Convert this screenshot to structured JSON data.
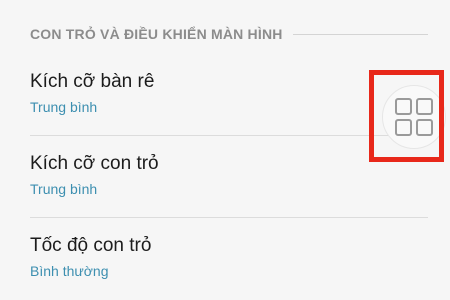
{
  "section": {
    "title": "CON TRỎ VÀ ĐIỀU KHIỂN MÀN HÌNH"
  },
  "items": [
    {
      "title": "Kích cỡ bàn rê",
      "value": "Trung bình"
    },
    {
      "title": "Kích cỡ con trỏ",
      "value": "Trung bình"
    },
    {
      "title": "Tốc độ con trỏ",
      "value": "Bình thường"
    }
  ],
  "floating_button": {
    "icon": "grid-icon"
  },
  "colors": {
    "accent": "#3d8fb0",
    "highlight": "#e8281a",
    "header_text": "#8c8c8c",
    "background": "#f6f6f6"
  }
}
